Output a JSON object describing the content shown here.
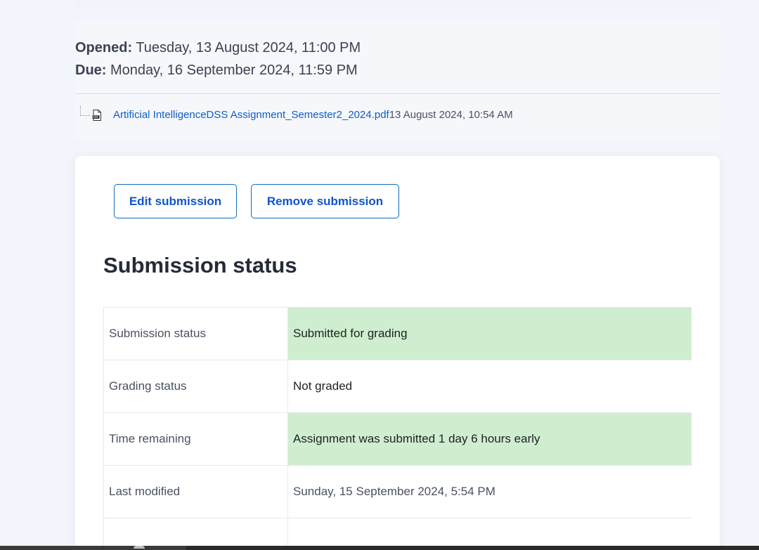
{
  "assignment": {
    "opened_label": "Opened:",
    "opened_value": "Tuesday, 13 August 2024, 11:00 PM",
    "due_label": "Due:",
    "due_value": "Monday, 16 September 2024, 11:59 PM"
  },
  "attachment": {
    "icon": "pdf-file-icon",
    "name": "Artificial IntelligenceDSS Assignment_Semester2_2024.pdf",
    "date": "13 August 2024, 10:54 AM"
  },
  "actions": {
    "edit_label": "Edit submission",
    "remove_label": "Remove submission"
  },
  "submission_status": {
    "title": "Submission status",
    "rows": [
      {
        "key": "Submission status",
        "value": "Submitted for grading",
        "highlight": true
      },
      {
        "key": "Grading status",
        "value": "Not graded",
        "highlight": false
      },
      {
        "key": "Time remaining",
        "value": "Assignment was submitted 1 day 6 hours early",
        "highlight": true
      },
      {
        "key": "Last modified",
        "value": "Sunday, 15 September 2024, 5:54 PM",
        "highlight": false
      }
    ]
  },
  "colors": {
    "accent": "#0f6cbf",
    "success_bg": "#cfeecf",
    "page_bg": "#f2f5fb"
  }
}
